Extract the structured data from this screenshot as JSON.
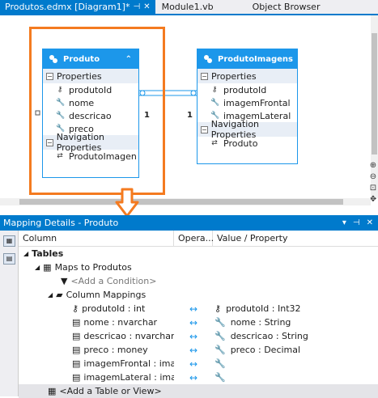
{
  "tabs": [
    {
      "label": "Produtos.edmx [Diagram1]*",
      "pin": "⊣",
      "close": "✕",
      "active": true
    },
    {
      "label": "Module1.vb",
      "active": false
    },
    {
      "label": "Object Browser",
      "active": false
    }
  ],
  "entities": [
    {
      "title": "Produto",
      "properties_label": "Properties",
      "properties": [
        {
          "name": "produtoId",
          "icon": "key-icon"
        },
        {
          "name": "nome",
          "icon": "wrench-icon"
        },
        {
          "name": "descricao",
          "icon": "wrench-icon"
        },
        {
          "name": "preco",
          "icon": "wrench-icon"
        }
      ],
      "nav_label": "Navigation Properties",
      "nav": [
        "ProdutoImagen"
      ]
    },
    {
      "title": "ProdutoImagens",
      "properties_label": "Properties",
      "properties": [
        {
          "name": "produtoId",
          "icon": "key-icon"
        },
        {
          "name": "imagemFrontal",
          "icon": "wrench-icon"
        },
        {
          "name": "imagemLateral",
          "icon": "wrench-icon"
        }
      ],
      "nav_label": "Navigation Properties",
      "nav": [
        "Produto"
      ]
    }
  ],
  "association": {
    "left": "1",
    "right": "1"
  },
  "panel": {
    "title": "Mapping Details - Produto"
  },
  "columns": {
    "column": "Column",
    "operator": "Opera...",
    "value": "Value / Property"
  },
  "tree": {
    "tables": "Tables",
    "maps_to": "Maps to Produtos",
    "add_condition": "<Add a Condition>",
    "column_mappings": "Column Mappings",
    "mappings": [
      {
        "column": "produtoId : int",
        "op": "↔",
        "value": "produtoId : Int32",
        "key": true
      },
      {
        "column": "nome : nvarchar",
        "op": "↔",
        "value": "nome : String"
      },
      {
        "column": "descricao : nvarchar",
        "op": "↔",
        "value": "descricao : String"
      },
      {
        "column": "preco : money",
        "op": "↔",
        "value": "preco : Decimal"
      },
      {
        "column": "imagemFrontal : image",
        "op": "↔",
        "value": ""
      },
      {
        "column": "imagemLateral : image",
        "op": "↔",
        "value": ""
      }
    ],
    "add_table": "<Add a Table or View>"
  },
  "colors": {
    "accent": "#007acc",
    "entity": "#1c97ea",
    "highlight": "#f47b20"
  }
}
